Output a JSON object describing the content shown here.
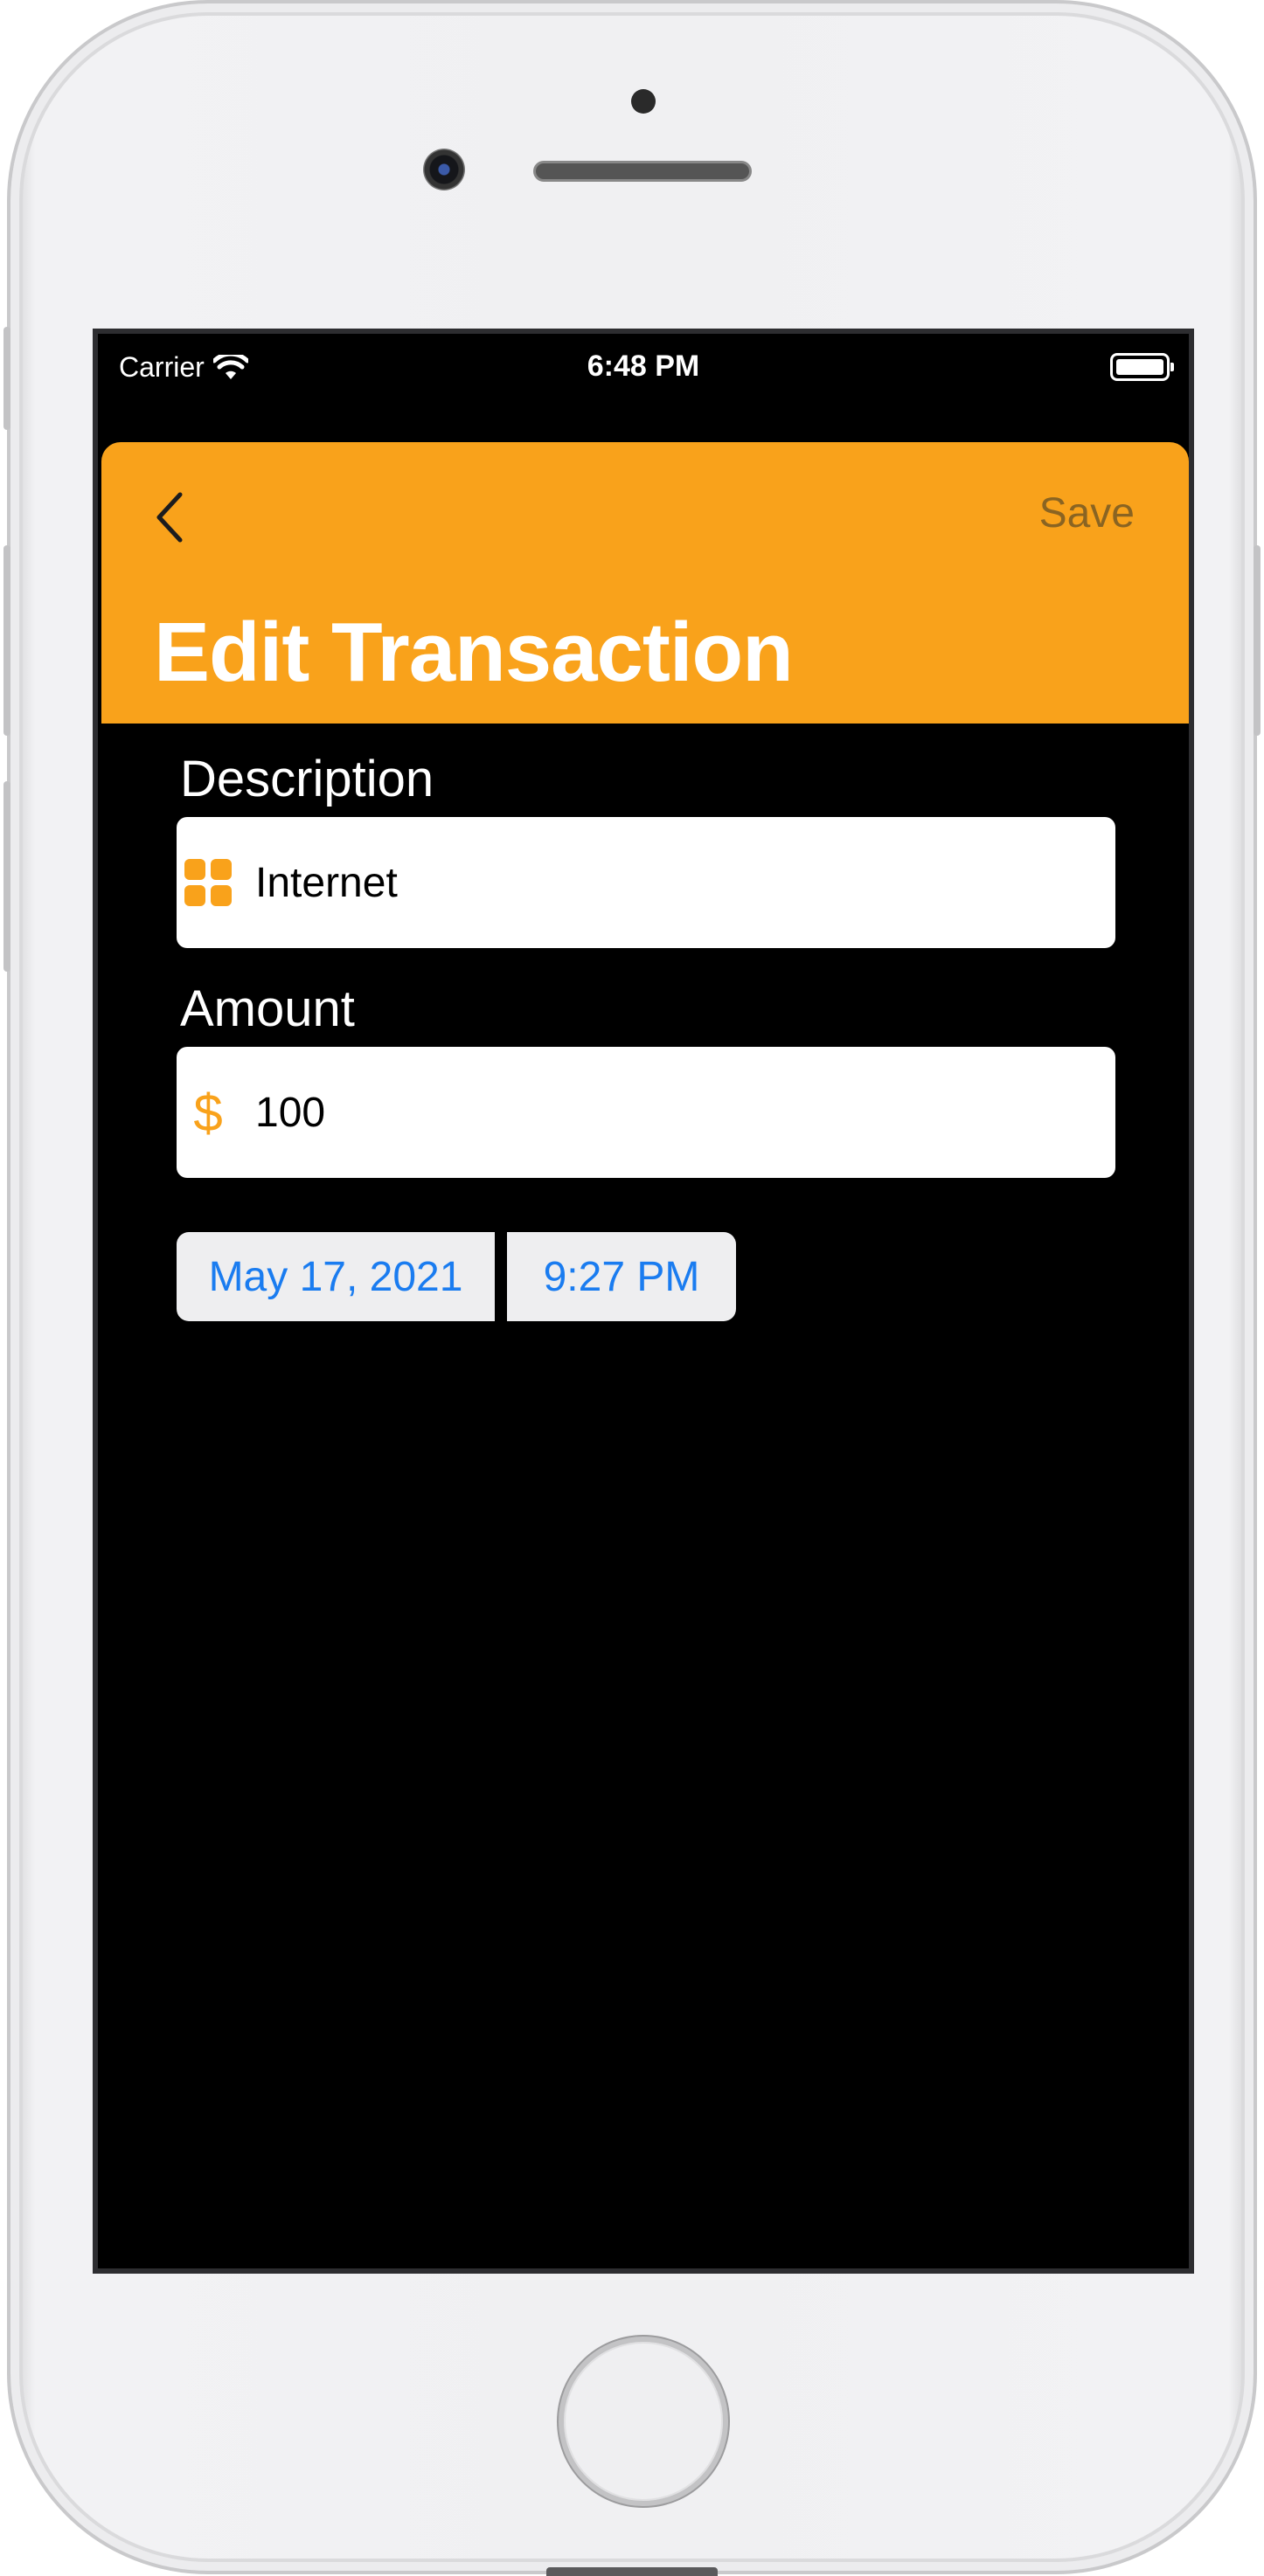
{
  "status_bar": {
    "carrier": "Carrier",
    "time": "6:48 PM"
  },
  "nav": {
    "title": "Edit Transaction",
    "save_label": "Save"
  },
  "form": {
    "description": {
      "label": "Description",
      "value": "Internet",
      "icon": "category-grid-icon"
    },
    "amount": {
      "label": "Amount",
      "value": "100",
      "currency_symbol": "$"
    },
    "date": "May 17, 2021",
    "time": "9:27 PM"
  },
  "colors": {
    "accent": "#f9a21b",
    "save_text": "#8a6422",
    "picker_text": "#1a7cf0",
    "background": "#000000"
  }
}
